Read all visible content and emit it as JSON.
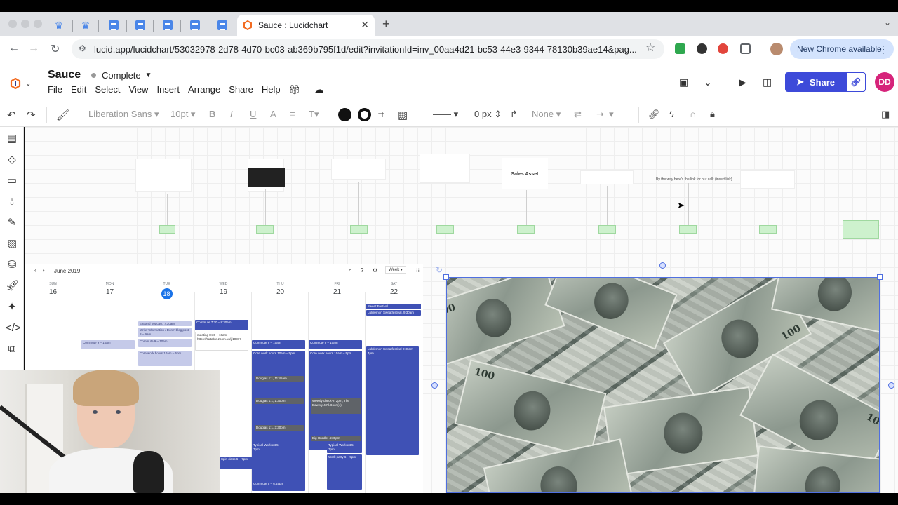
{
  "browser": {
    "active_tab_title": "Sauce : Lucidchart",
    "url": "lucid.app/lucidchart/53032978-2d78-4d70-bc03-ab369b795f1d/edit?invitationId=inv_00aa4d21-bc53-44e3-9344-78130b39ae14&pag...",
    "update_label": "New Chrome available"
  },
  "app": {
    "doc_title": "Sauce",
    "status": "Complete",
    "menu": [
      "File",
      "Edit",
      "Select",
      "View",
      "Insert",
      "Arrange",
      "Share",
      "Help"
    ],
    "share_label": "Share",
    "avatar_initials": "DD"
  },
  "toolbar": {
    "font": "Liberation Sans",
    "font_size": "10pt",
    "line_width": "0 px",
    "arrow_style": "None"
  },
  "canvas": {
    "sales_asset_label": "Sales Asset",
    "note_text": "By the way here's the link for our call: (insert link)"
  },
  "calendar": {
    "month_label": "June 2019",
    "view_label": "Week",
    "days": [
      {
        "name": "SUN",
        "num": "16"
      },
      {
        "name": "MON",
        "num": "17"
      },
      {
        "name": "TUE",
        "num": "18"
      },
      {
        "name": "WED",
        "num": "19"
      },
      {
        "name": "THU",
        "num": "20"
      },
      {
        "name": "FRI",
        "num": "21"
      },
      {
        "name": "SAT",
        "num": "22"
      }
    ],
    "events": {
      "sweat_festival": "Sweat Festival",
      "lululemon_sweatfestival": "Lululemon Sweatfestival, 9:30am",
      "lululemon_block": "Lululemon Sweatfestival 9:30am – 4pm",
      "eat_podcast": "Eat and podcast, 7:30am",
      "write_info": "Write 'Information / Done' blog post 8 – 9am",
      "commute_tue": "Commute 9 – 10am",
      "commute_wed": "Commute 7:30 – 8:30am",
      "meeting_wed": "meeting 8:30 – 10am https://tartable.zoom.us/j/10377",
      "commute_thu": "Commute 9 – 10am",
      "commute_fri": "Commute 9 – 10am",
      "commute_mon": "Commute 9 – 10am",
      "core_work": "Core work hours 10am – 5pm",
      "douglas_1": "Douglas 1:1, 11:45am",
      "douglas_2": "Douglas 1:1, 1:30pm",
      "douglas_3": "Douglas 1:1, 3:30pm",
      "weekly_checkin": "Weekly check-in 2pm, The Bowery 4-Fl.Door (4)",
      "big_huddle": "Big Huddle, 4:30pm",
      "typical_workout": "Typical Workout 5 – 7pm",
      "spin_class": "Spin class 6 – 7pm",
      "work_party": "Work party 6 – 9pm",
      "commute_evening": "Commute 5 – 6:45pm"
    }
  },
  "colors": {
    "accent": "#3d4ad9",
    "avatar": "#d6237a",
    "calendar_event": "#3f51b5",
    "today": "#1a73e8"
  }
}
